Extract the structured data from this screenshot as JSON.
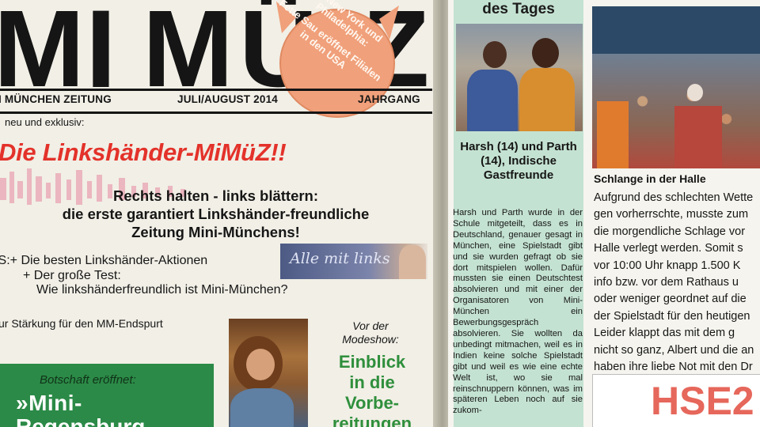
{
  "left_page": {
    "masthead": {
      "letters": [
        "M",
        "I",
        "M",
        "Ü",
        "Z"
      ],
      "pig_line1": "In New York und Philadelphia:",
      "pig_line2": "Fette Sau eröffnet Filialen in den USA",
      "sub_left": "I MÜNCHEN ZEITUNG",
      "sub_center": "JULI/AUGUST 2014",
      "sub_right": "JAHRGANG"
    },
    "intro": "neu und exklusiv:",
    "headline": "Die Linkshänder-MiMüZ!!",
    "subheadline": [
      "Rechts halten - links blättern:",
      "die erste garantiert Linkshänder-freundliche",
      "Zeitung Mini-Münchens!"
    ],
    "plus_lines": [
      "US:+ Die besten Linkshänder-Aktionen",
      "+ Der große Test:",
      "Wie linkshänderfreundlich ist Mini-München?"
    ],
    "chalk_text": "Alle mit links",
    "endspurt": "ur Stärkung für den MM-Endspurt",
    "green_box": {
      "top": "Botschaft eröffnet:",
      "title": "»Mini-",
      "title2": "Regensburg"
    },
    "mode": {
      "top": "Vor der Modeshow:",
      "title": "Einblick in die Vorbe-reitungen"
    }
  },
  "right_page": {
    "column_header": "des Tages",
    "caption_title": "Harsh (14) und Parth (14), Indische Gastfreunde",
    "caption_body": "Harsh und Parth wurde in der Schule mitgeteilt, dass es in Deutschland, genauer gesagt in München, eine Spielstadt gibt und sie wurden gefragt ob sie dort mitspielen wollen. Dafür mussten sie einen Deutschtest absolvieren und mit einer der Organisatoren von Mini-München ein Bewerbungsgespräch absolvieren. Sie wollten da unbedingt mitmachen, weil es in Indien keine solche Spielstadt gibt und weil es wie eine echte Welt ist, wo sie mal reinschnuppern können, was im späteren Leben noch auf sie zukom-",
    "photo_headline": "Schlange in der Halle",
    "body_lines": [
      "Aufgrund des schlechten Wette",
      "gen vorherrschte, musste zum",
      "die morgendliche Schlage vor",
      "Halle verlegt werden. Somit s",
      "vor 10:00 Uhr knapp 1.500 K",
      "info bzw. vor dem Rathaus u",
      "oder weniger geordnet auf die",
      "der Spielstadt für den heutigen",
      "Leider klappt das mit dem g",
      "nicht so ganz, Albert und die an",
      "haben ihre liebe Not mit den Dr"
    ],
    "hse_text": "HSE2"
  },
  "colors": {
    "red": "#e3322a",
    "pig": "#f0a07a",
    "green": "#2b8a47",
    "teal": "#c4e2d2",
    "ink": "#161616"
  }
}
